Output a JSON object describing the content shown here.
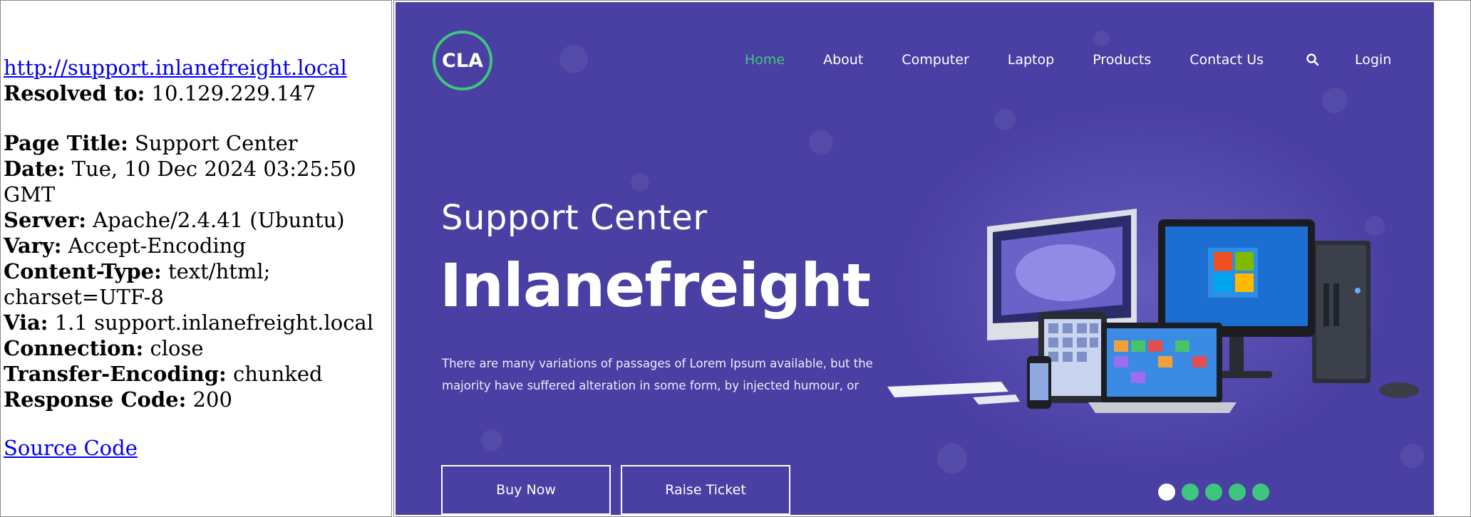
{
  "info": {
    "url": "http://support.inlanefreight.local",
    "resolved_label": "Resolved to:",
    "resolved_value": " 10.129.229.147",
    "page_title_label": "Page Title:",
    "page_title_value": " Support Center",
    "date_label": "Date:",
    "date_value_1": " Tue, 10 Dec 2024 03:25:50",
    "date_value_2": "GMT",
    "server_label": "Server:",
    "server_value": " Apache/2.4.41 (Ubuntu)",
    "vary_label": "Vary:",
    "vary_value": " Accept-Encoding",
    "content_type_label": "Content-Type:",
    "content_type_value_1": " text/html;",
    "content_type_value_2": "charset=UTF-8",
    "via_label": "Via:",
    "via_value": " 1.1 support.inlanefreight.local",
    "connection_label": "Connection:",
    "connection_value": " close",
    "transfer_label": "Transfer-Encoding:",
    "transfer_value": " chunked",
    "response_label": "Response Code:",
    "response_value": " 200",
    "source_link": "Source Code"
  },
  "site": {
    "logo_text": "CLA",
    "nav": [
      {
        "label": "Home"
      },
      {
        "label": "About"
      },
      {
        "label": "Computer"
      },
      {
        "label": "Laptop"
      },
      {
        "label": "Products"
      },
      {
        "label": "Contact Us"
      }
    ],
    "login_label": "Login",
    "kicker": "Support Center",
    "headline": "Inlanefreight",
    "blurb": "There are many variations of passages of Lorem Ipsum available, but the majority have suffered alteration in some form, by injected humour, or",
    "buy_label": "Buy Now",
    "ticket_label": "Raise Ticket",
    "slide_count": 5,
    "active_slide": 1,
    "icons": [
      "search-icon",
      "devices-illustration"
    ],
    "colors": {
      "hero_bg": "#4a3fa2",
      "accent": "#3ec67e",
      "link": "#0000ee"
    }
  }
}
